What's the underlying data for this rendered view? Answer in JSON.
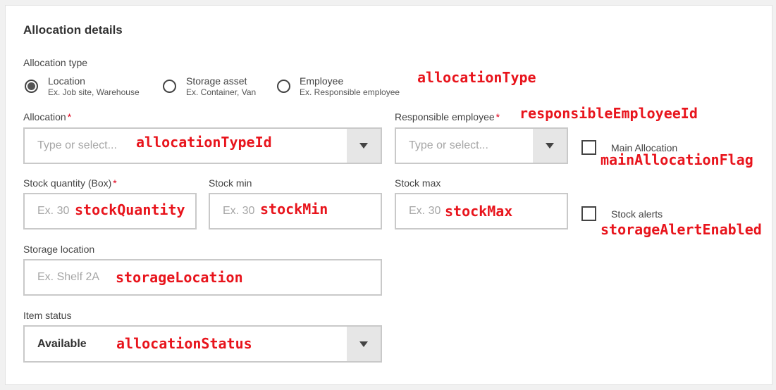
{
  "section": {
    "title": "Allocation details"
  },
  "allocation_type": {
    "label": "Allocation type",
    "options": [
      {
        "title": "Location",
        "subtitle": "Ex. Job site, Warehouse",
        "selected": true
      },
      {
        "title": "Storage asset",
        "subtitle": "Ex. Container, Van",
        "selected": false
      },
      {
        "title": "Employee",
        "subtitle": "Ex. Responsible employee",
        "selected": false
      }
    ],
    "annotation": "allocationType"
  },
  "allocation": {
    "label": "Allocation",
    "required_mark": "*",
    "placeholder": "Type or select...",
    "annotation": "allocationTypeId"
  },
  "responsible_employee": {
    "label": "Responsible employee",
    "required_mark": "*",
    "placeholder": "Type or select...",
    "annotation": "responsibleEmployeeId"
  },
  "main_allocation": {
    "label": "Main Allocation",
    "checked": false,
    "annotation": "mainAllocationFlag"
  },
  "stock_quantity": {
    "label": "Stock quantity (Box)",
    "required_mark": "*",
    "placeholder": "Ex. 30",
    "annotation": "stockQuantity"
  },
  "stock_min": {
    "label": "Stock min",
    "placeholder": "Ex. 30",
    "annotation": "stockMin"
  },
  "stock_max": {
    "label": "Stock max",
    "placeholder": "Ex. 30",
    "annotation": "stockMax"
  },
  "stock_alerts": {
    "label": "Stock alerts",
    "checked": false,
    "annotation": "storageAlertEnabled"
  },
  "storage_location": {
    "label": "Storage location",
    "placeholder": "Ex. Shelf 2A",
    "annotation": "storageLocation"
  },
  "item_status": {
    "label": "Item status",
    "value": "Available",
    "annotation": "allocationStatus"
  },
  "colors": {
    "required": "#e0001b",
    "annotation": "#e8141c",
    "border": "#c9c9c9",
    "dropdown_button": "#e6e6e6"
  }
}
